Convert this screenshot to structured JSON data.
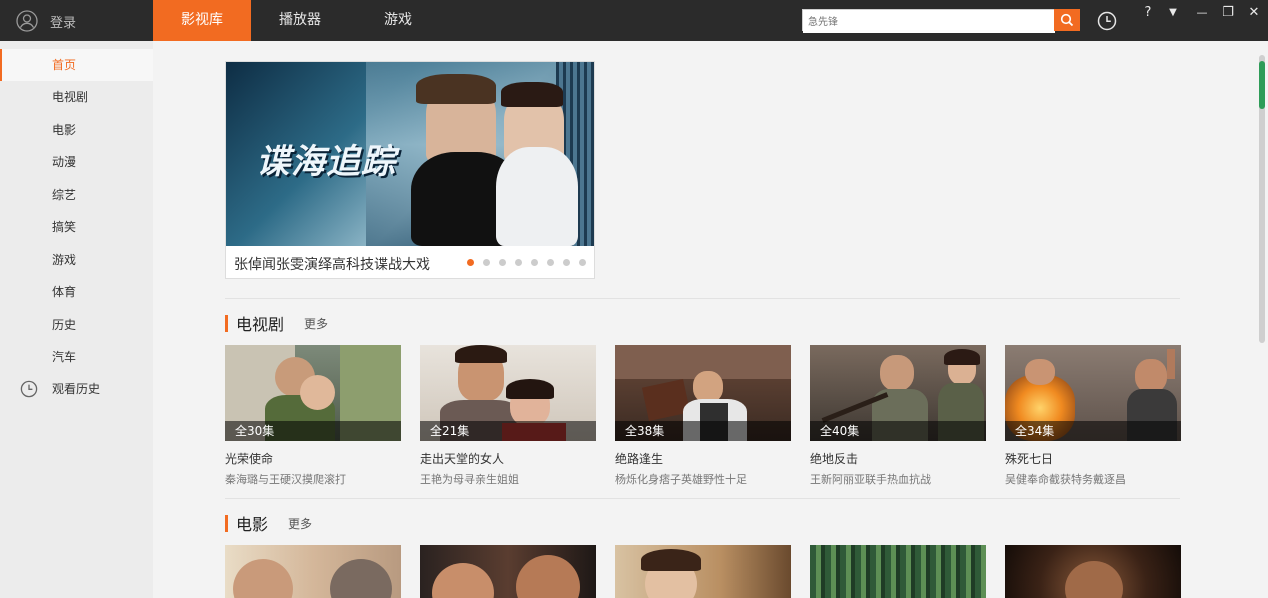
{
  "header": {
    "login_label": "登录",
    "tabs": [
      {
        "label": "影视库",
        "active": true
      },
      {
        "label": "播放器",
        "active": false
      },
      {
        "label": "游戏",
        "active": false
      }
    ],
    "search_placeholder": "急先锋",
    "window_controls": [
      "?",
      "▼",
      "—",
      "❐",
      "✕"
    ]
  },
  "sidebar": {
    "items": [
      {
        "label": "首页",
        "active": true
      },
      {
        "label": "电视剧"
      },
      {
        "label": "电影"
      },
      {
        "label": "动漫"
      },
      {
        "label": "综艺"
      },
      {
        "label": "搞笑"
      },
      {
        "label": "游戏"
      },
      {
        "label": "体育"
      },
      {
        "label": "历史"
      },
      {
        "label": "汽车"
      },
      {
        "label": "观看历史",
        "icon": "clock-icon"
      }
    ]
  },
  "banner": {
    "art_text": "谍海追踪",
    "caption": "张倬闻张雯演绎高科技谍战大戏",
    "slide_count": 8,
    "active_slide": 1
  },
  "sections": [
    {
      "title": "电视剧",
      "more": "更多",
      "cards": [
        {
          "episodes": "全30集",
          "title": "光荣使命",
          "desc": "秦海璐与王硬汉摸爬滚打"
        },
        {
          "episodes": "全21集",
          "title": "走出天堂的女人",
          "desc": "王艳为母寻亲生姐姐"
        },
        {
          "episodes": "全38集",
          "title": "绝路逢生",
          "desc": "杨烁化身痞子英雄野性十足"
        },
        {
          "episodes": "全40集",
          "title": "绝地反击",
          "desc": "王新阿丽亚联手热血抗战"
        },
        {
          "episodes": "全34集",
          "title": "殊死七日",
          "desc": "吴健奉命截获特务戴逐昌"
        }
      ]
    },
    {
      "title": "电影",
      "more": "更多"
    }
  ],
  "colors": {
    "accent": "#f26b21",
    "topbar": "#2b2b2b",
    "sidebar": "#ececec",
    "background": "#f3f3f3"
  }
}
